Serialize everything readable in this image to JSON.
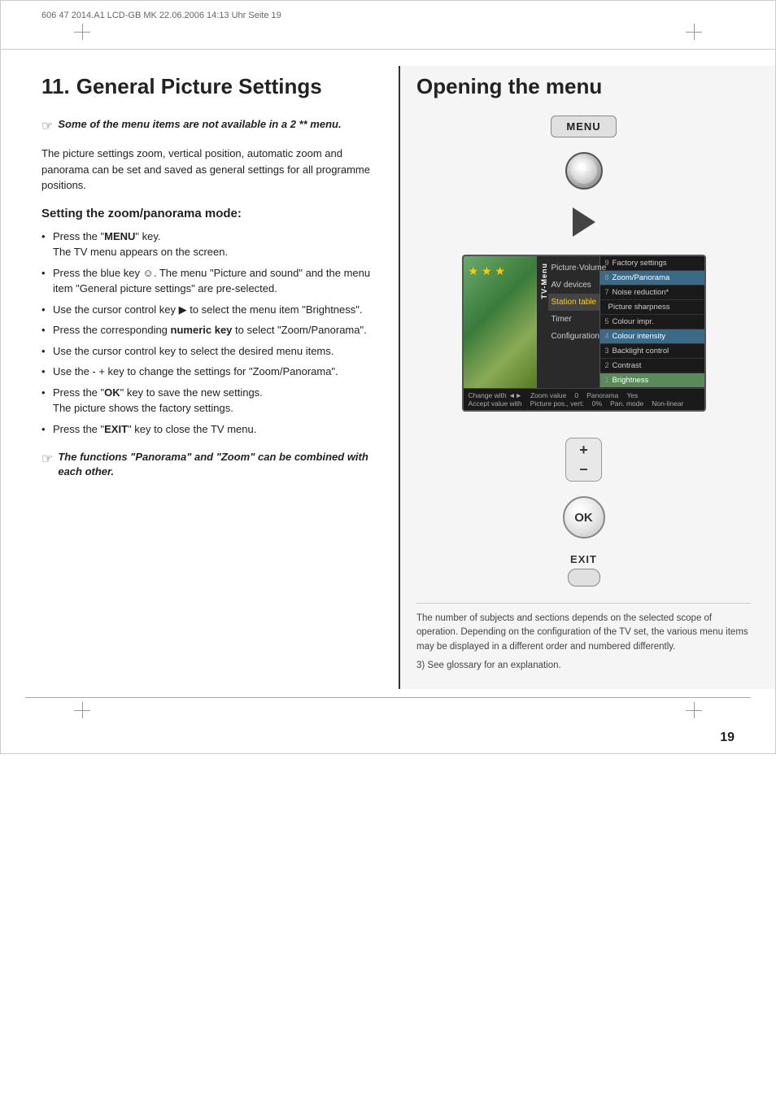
{
  "header": {
    "file_info": "606 47 2014.A1 LCD-GB MK 22.06.2006 14:13 Uhr Seite 19"
  },
  "left_column": {
    "section_number": "11.",
    "section_title": "General Picture Settings",
    "note_icon": "☞",
    "note_text": "Some of the menu items are not available in a 2 ** menu.",
    "body_text": "The picture settings zoom, vertical position, automatic zoom and panorama can be set and saved as general settings for all programme positions.",
    "sub_heading": "Setting the zoom/panorama mode:",
    "bullet_items": [
      {
        "text": "Press the \"MENU\" key.",
        "sub_text": "The TV menu appears on the screen."
      },
      {
        "text": "Press the blue key ☺. The menu \"Picture and sound\" and the menu item \"General picture settings\" are pre-selected."
      },
      {
        "text": "Use the cursor control key ▶ to select the menu item \"Brightness\"."
      },
      {
        "text": "Press the corresponding numeric key to select \"Zoom/Panorama\"."
      },
      {
        "text": "Use the cursor control key to select the desired menu items."
      },
      {
        "text": "Use the - + key to change the settings for \"Zoom/Panorama\"."
      },
      {
        "text": "Press the \"OK\" key to save the new settings.",
        "sub_text": "The picture shows the factory settings."
      },
      {
        "text": "Press the \"EXIT\" key to close the TV menu."
      }
    ],
    "bottom_note_text": "The functions \"Panorama\" and \"Zoom\" can be combined with each other."
  },
  "right_column": {
    "title": "Opening the menu",
    "menu_button_label": "MENU",
    "ok_button_label": "OK",
    "exit_label": "EXIT",
    "plus_label": "+",
    "minus_label": "–",
    "tv_menu": {
      "nav_label": "TV-Menu",
      "nav_items": [
        {
          "label": "Picture·Volume",
          "active": false
        },
        {
          "label": "AV devices",
          "active": false
        },
        {
          "label": "Station table",
          "active": true
        },
        {
          "label": "Timer",
          "active": false
        },
        {
          "label": "Configuration",
          "active": false
        }
      ],
      "right_items": [
        {
          "num": "9",
          "label": "Factory settings",
          "highlighted": false
        },
        {
          "num": "8",
          "label": "Zoom/Panorama",
          "highlighted": true
        },
        {
          "num": "7",
          "label": "Noise reduction*",
          "highlighted": false
        },
        {
          "num": "",
          "label": "Picture sharpness",
          "highlighted": false
        },
        {
          "num": "5",
          "label": "Colour impr.",
          "highlighted": false
        },
        {
          "num": "4",
          "label": "Colour intensity",
          "highlighted": true
        },
        {
          "num": "3",
          "label": "Backlight control",
          "highlighted": false
        },
        {
          "num": "2",
          "label": "Contrast",
          "highlighted": false
        },
        {
          "num": "1",
          "label": "Brightness",
          "highlighted": true
        }
      ],
      "bottom_rows": [
        "Change with ◄►     Zoom value   0    Panorama    Yes",
        "Accept value with    Picture pos., vert:   0%    Pan. mode   Non-linear"
      ]
    },
    "footer_note_lines": [
      "The number of subjects and sections depends",
      "on the selected scope of operation. Depending",
      "on the configuration of the TV set, the various",
      "menu items may be displayed in a different",
      "order and numbered differently.",
      "3) See glossary for an explanation."
    ]
  },
  "page_number": "19"
}
